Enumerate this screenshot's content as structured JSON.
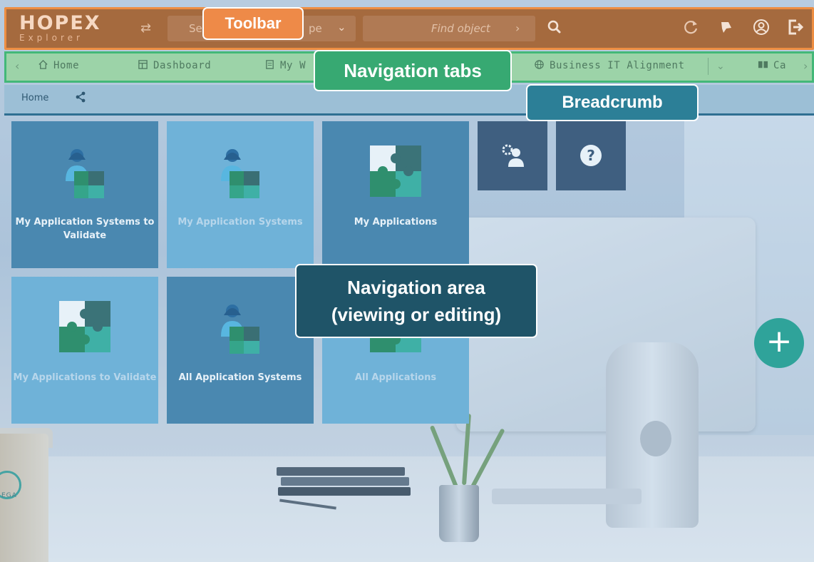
{
  "toolbar": {
    "logo": "HOPEX",
    "logo_sub": "Explorer",
    "search_placeholder": "Se",
    "search_placeholder_tail": "pe",
    "find_placeholder": "Find object"
  },
  "tabs": [
    {
      "label": "Home",
      "icon": "house-icon"
    },
    {
      "label": "Dashboard",
      "icon": "dashboard-icon"
    },
    {
      "label": "My W",
      "icon": "document-icon"
    },
    {
      "label": "Business IT Alignment",
      "icon": "globe-icon"
    },
    {
      "label": "Ca",
      "icon": "book-icon"
    }
  ],
  "breadcrumb": {
    "home": "Home"
  },
  "tiles": [
    {
      "label": "My Application Systems to Validate",
      "icon": "person-puzzle-icon"
    },
    {
      "label": "My Application Systems",
      "icon": "person-puzzle-icon"
    },
    {
      "label": "My Applications",
      "icon": "puzzle-icon"
    },
    {
      "label": "",
      "icon": "person-gear-icon"
    },
    {
      "label": "",
      "icon": "question-icon"
    },
    {
      "label": "My Applications to Validate",
      "icon": "puzzle-icon"
    },
    {
      "label": "All Application Systems",
      "icon": "person-puzzle-icon"
    },
    {
      "label": "All Applications",
      "icon": "puzzle-icon"
    }
  ],
  "background": {
    "brand_text": "EGA"
  },
  "annotations": {
    "toolbar": "Toolbar",
    "navigation_tabs": "Navigation tabs",
    "breadcrumb": "Breadcrumb",
    "navigation_area_line1": "Navigation area",
    "navigation_area_line2": "(viewing or editing)"
  },
  "colors": {
    "toolbar_bg": "#a56a3e",
    "toolbar_border": "#ee8e42",
    "tabs_bg": "#9cd3a8",
    "tabs_border": "#43b878",
    "breadcrumb_bg": "#9cbfd6",
    "tile_dark": "#4a88b0",
    "tile_light": "#6fb2d8",
    "tile_navy": "#3f5f80",
    "fab": "#2fa39a"
  }
}
